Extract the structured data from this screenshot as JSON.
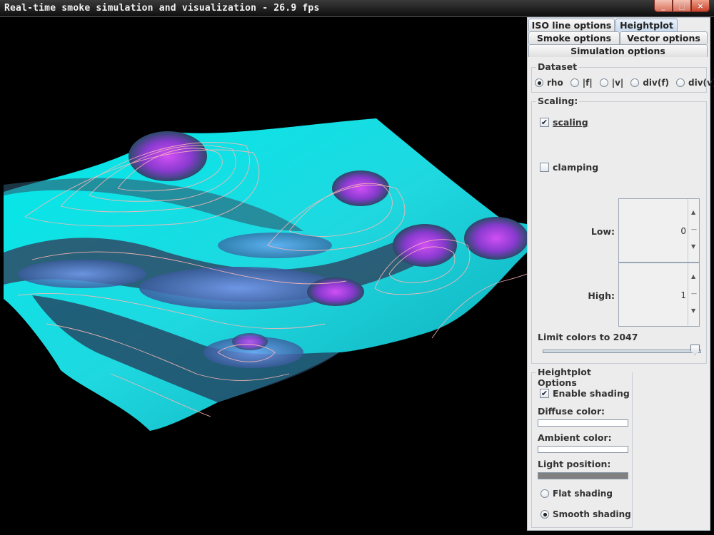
{
  "window": {
    "title": "Real-time smoke simulation and visualization - 26.9 fps",
    "buttons": [
      "_",
      "□",
      "×"
    ]
  },
  "tabs": {
    "row1": [
      "ISO line options",
      "Heightplot"
    ],
    "row2": [
      "Smoke options",
      "Vector options"
    ],
    "row3": [
      "Simulation options"
    ],
    "active": "Heightplot"
  },
  "dataset": {
    "title": "Dataset",
    "options": [
      "rho",
      "|f|",
      "|v|",
      "div(f)",
      "div(v)"
    ],
    "selected": "rho"
  },
  "scaling": {
    "title": "Scaling:",
    "scaling_label": "scaling",
    "scaling_checked": true,
    "clamping_label": "clamping",
    "clamping_checked": false,
    "low_label": "Low:",
    "low_value": "0",
    "high_label": "High:",
    "high_value": "1",
    "limit_label": "Limit colors to 2047",
    "limit_value": 2047
  },
  "heightplot": {
    "title": "Heightplot Options",
    "enable_shading_label": "Enable shading",
    "enable_shading_checked": true,
    "diffuse_label": "Diffuse color:",
    "ambient_label": "Ambient color:",
    "light_label": "Light position:",
    "flat_label": "Flat shading",
    "smooth_label": "Smooth shading",
    "shading_mode": "smooth",
    "colors": {
      "diffuse": "#ffffff",
      "ambient": "#ffffff",
      "light": "#808080"
    }
  },
  "visualization": {
    "colors": {
      "low": "#00e5e5",
      "mid": "#6a8cf0",
      "high": "#b030e0",
      "iso": "#ffb0b0"
    }
  }
}
